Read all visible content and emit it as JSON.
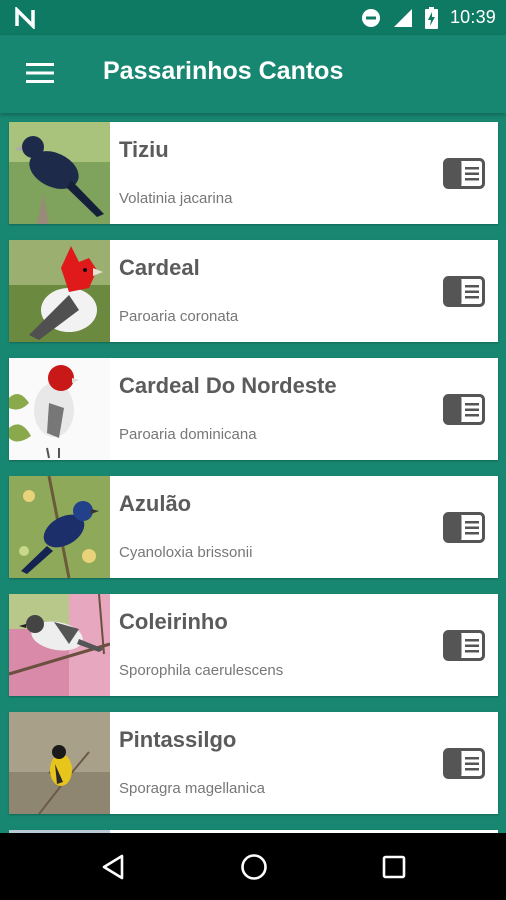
{
  "status": {
    "time": "10:39"
  },
  "appbar": {
    "title": "Passarinhos Cantos"
  },
  "birds": [
    {
      "name": "Tiziu",
      "scientific": "Volatinia jacarina"
    },
    {
      "name": "Cardeal",
      "scientific": "Paroaria coronata"
    },
    {
      "name": "Cardeal Do Nordeste",
      "scientific": "Paroaria dominicana"
    },
    {
      "name": "Azulão",
      "scientific": "Cyanoloxia brissonii"
    },
    {
      "name": "Coleirinho",
      "scientific": "Sporophila caerulescens"
    },
    {
      "name": "Pintassilgo",
      "scientific": "Sporagra magellanica"
    }
  ],
  "colors": {
    "primary": "#188771",
    "statusbar": "#0f7a63"
  }
}
